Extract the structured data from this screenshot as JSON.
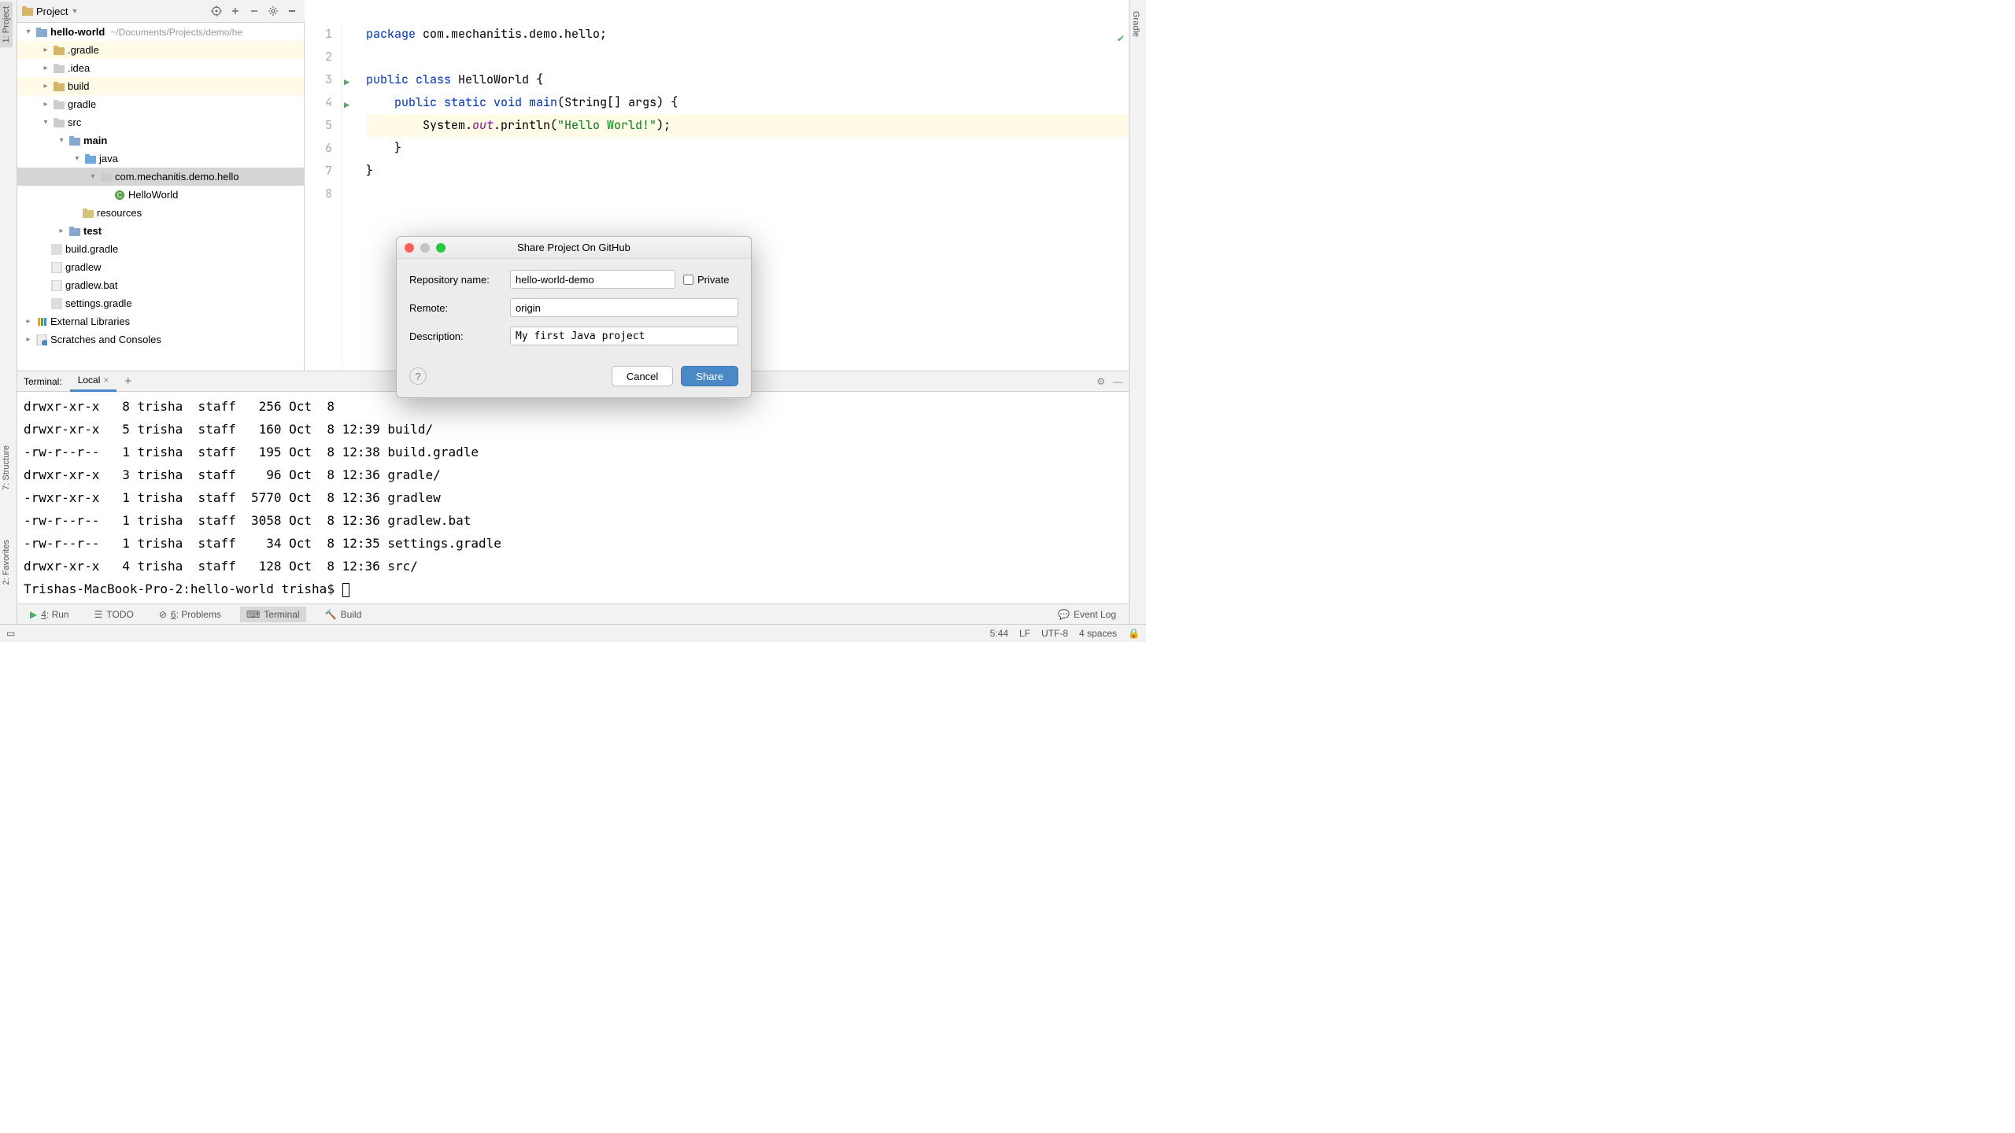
{
  "projectHeader": {
    "label": "Project"
  },
  "tree": {
    "root": "hello-world",
    "rootPath": "~/Documents/Projects/demo/he",
    "items": {
      "gradleDot": ".gradle",
      "idea": ".idea",
      "build": "build",
      "gradle": "gradle",
      "src": "src",
      "main": "main",
      "java": "java",
      "pkg": "com.mechanitis.demo.hello",
      "cls": "HelloWorld",
      "resources": "resources",
      "test": "test",
      "buildGradle": "build.gradle",
      "gradlew": "gradlew",
      "gradlewBat": "gradlew.bat",
      "settingsGradle": "settings.gradle",
      "extLib": "External Libraries",
      "scratches": "Scratches and Consoles"
    }
  },
  "editor": {
    "lines": [
      {
        "pre": "",
        "tokens": [
          [
            "kw",
            "package"
          ],
          [
            "",
            " com.mechanitis.demo.hello;"
          ]
        ]
      },
      {
        "pre": "",
        "tokens": []
      },
      {
        "pre": "",
        "tokens": [
          [
            "kw",
            "public class"
          ],
          [
            "",
            " HelloWorld {"
          ]
        ]
      },
      {
        "pre": "    ",
        "tokens": [
          [
            "kw",
            "public static void"
          ],
          [
            "",
            " "
          ],
          [
            "kw",
            "main"
          ],
          [
            "",
            "(String[] args) {"
          ]
        ]
      },
      {
        "pre": "        ",
        "tokens": [
          [
            "",
            "System."
          ],
          [
            "field",
            "out"
          ],
          [
            "",
            ".println("
          ],
          [
            "str",
            "\"Hello World!\""
          ],
          [
            "",
            ");"
          ]
        ]
      },
      {
        "pre": "    ",
        "tokens": [
          [
            "",
            "}"
          ]
        ]
      },
      {
        "pre": "",
        "tokens": [
          [
            "",
            "}"
          ]
        ]
      },
      {
        "pre": "",
        "tokens": []
      }
    ]
  },
  "terminal": {
    "label": "Terminal:",
    "tab": "Local",
    "lines": [
      "drwxr-xr-x   8 trisha  staff   256 Oct  8",
      "drwxr-xr-x   5 trisha  staff   160 Oct  8 12:39 build/",
      "-rw-r--r--   1 trisha  staff   195 Oct  8 12:38 build.gradle",
      "drwxr-xr-x   3 trisha  staff    96 Oct  8 12:36 gradle/",
      "-rwxr-xr-x   1 trisha  staff  5770 Oct  8 12:36 gradlew",
      "-rw-r--r--   1 trisha  staff  3058 Oct  8 12:36 gradlew.bat",
      "-rw-r--r--   1 trisha  staff    34 Oct  8 12:35 settings.gradle",
      "drwxr-xr-x   4 trisha  staff   128 Oct  8 12:36 src/",
      "Trishas-MacBook-Pro-2:hello-world trisha$ "
    ]
  },
  "bottomBar": {
    "run": "Run",
    "runKey": "4",
    "todo": "TODO",
    "problems": "Problems",
    "problemsKey": "6",
    "terminal": "Terminal",
    "build": "Build",
    "eventLog": "Event Log"
  },
  "statusBar": {
    "pos": "5:44",
    "sep": "LF",
    "enc": "UTF-8",
    "indent": "4 spaces"
  },
  "leftTabs": {
    "project": "1: Project",
    "structure": "7: Structure",
    "favorites": "2: Favorites"
  },
  "rightTabs": {
    "gradle": "Gradle"
  },
  "dialog": {
    "title": "Share Project On GitHub",
    "repoLabel": "Repository name:",
    "repoValue": "hello-world-demo",
    "privateLabel": "Private",
    "remoteLabel": "Remote:",
    "remoteValue": "origin",
    "descLabel": "Description:",
    "descValue": "My first Java project",
    "cancel": "Cancel",
    "share": "Share"
  }
}
